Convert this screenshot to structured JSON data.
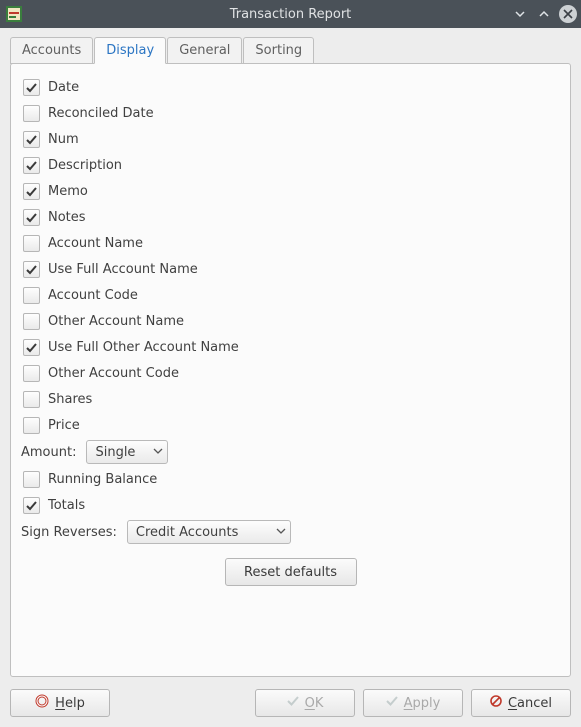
{
  "window": {
    "title": "Transaction Report"
  },
  "tabs": [
    {
      "label": "Accounts",
      "active": false
    },
    {
      "label": "Display",
      "active": true
    },
    {
      "label": "General",
      "active": false
    },
    {
      "label": "Sorting",
      "active": false
    }
  ],
  "options": {
    "date": {
      "label": "Date",
      "checked": true
    },
    "reconciled_date": {
      "label": "Reconciled Date",
      "checked": false
    },
    "num": {
      "label": "Num",
      "checked": true
    },
    "description": {
      "label": "Description",
      "checked": true
    },
    "memo": {
      "label": "Memo",
      "checked": true
    },
    "notes": {
      "label": "Notes",
      "checked": true
    },
    "account_name": {
      "label": "Account Name",
      "checked": false
    },
    "use_full_account": {
      "label": "Use Full Account Name",
      "checked": true
    },
    "account_code": {
      "label": "Account Code",
      "checked": false
    },
    "other_account_name": {
      "label": "Other Account Name",
      "checked": false
    },
    "use_full_other_acct": {
      "label": "Use Full Other Account Name",
      "checked": true
    },
    "other_account_code": {
      "label": "Other Account Code",
      "checked": false
    },
    "shares": {
      "label": "Shares",
      "checked": false
    },
    "price": {
      "label": "Price",
      "checked": false
    },
    "running_balance": {
      "label": "Running Balance",
      "checked": false
    },
    "totals": {
      "label": "Totals",
      "checked": true
    }
  },
  "amount": {
    "label": "Amount:",
    "value": "Single"
  },
  "sign_reverses": {
    "label": "Sign Reverses:",
    "value": "Credit Accounts"
  },
  "buttons": {
    "reset_defaults": "Reset defaults",
    "help": {
      "label": "Help",
      "mnemonic": "H"
    },
    "ok": {
      "label": "OK",
      "mnemonic": "O"
    },
    "apply": {
      "label": "Apply",
      "mnemonic": "A"
    },
    "cancel": {
      "label": "Cancel",
      "mnemonic": "C"
    }
  }
}
